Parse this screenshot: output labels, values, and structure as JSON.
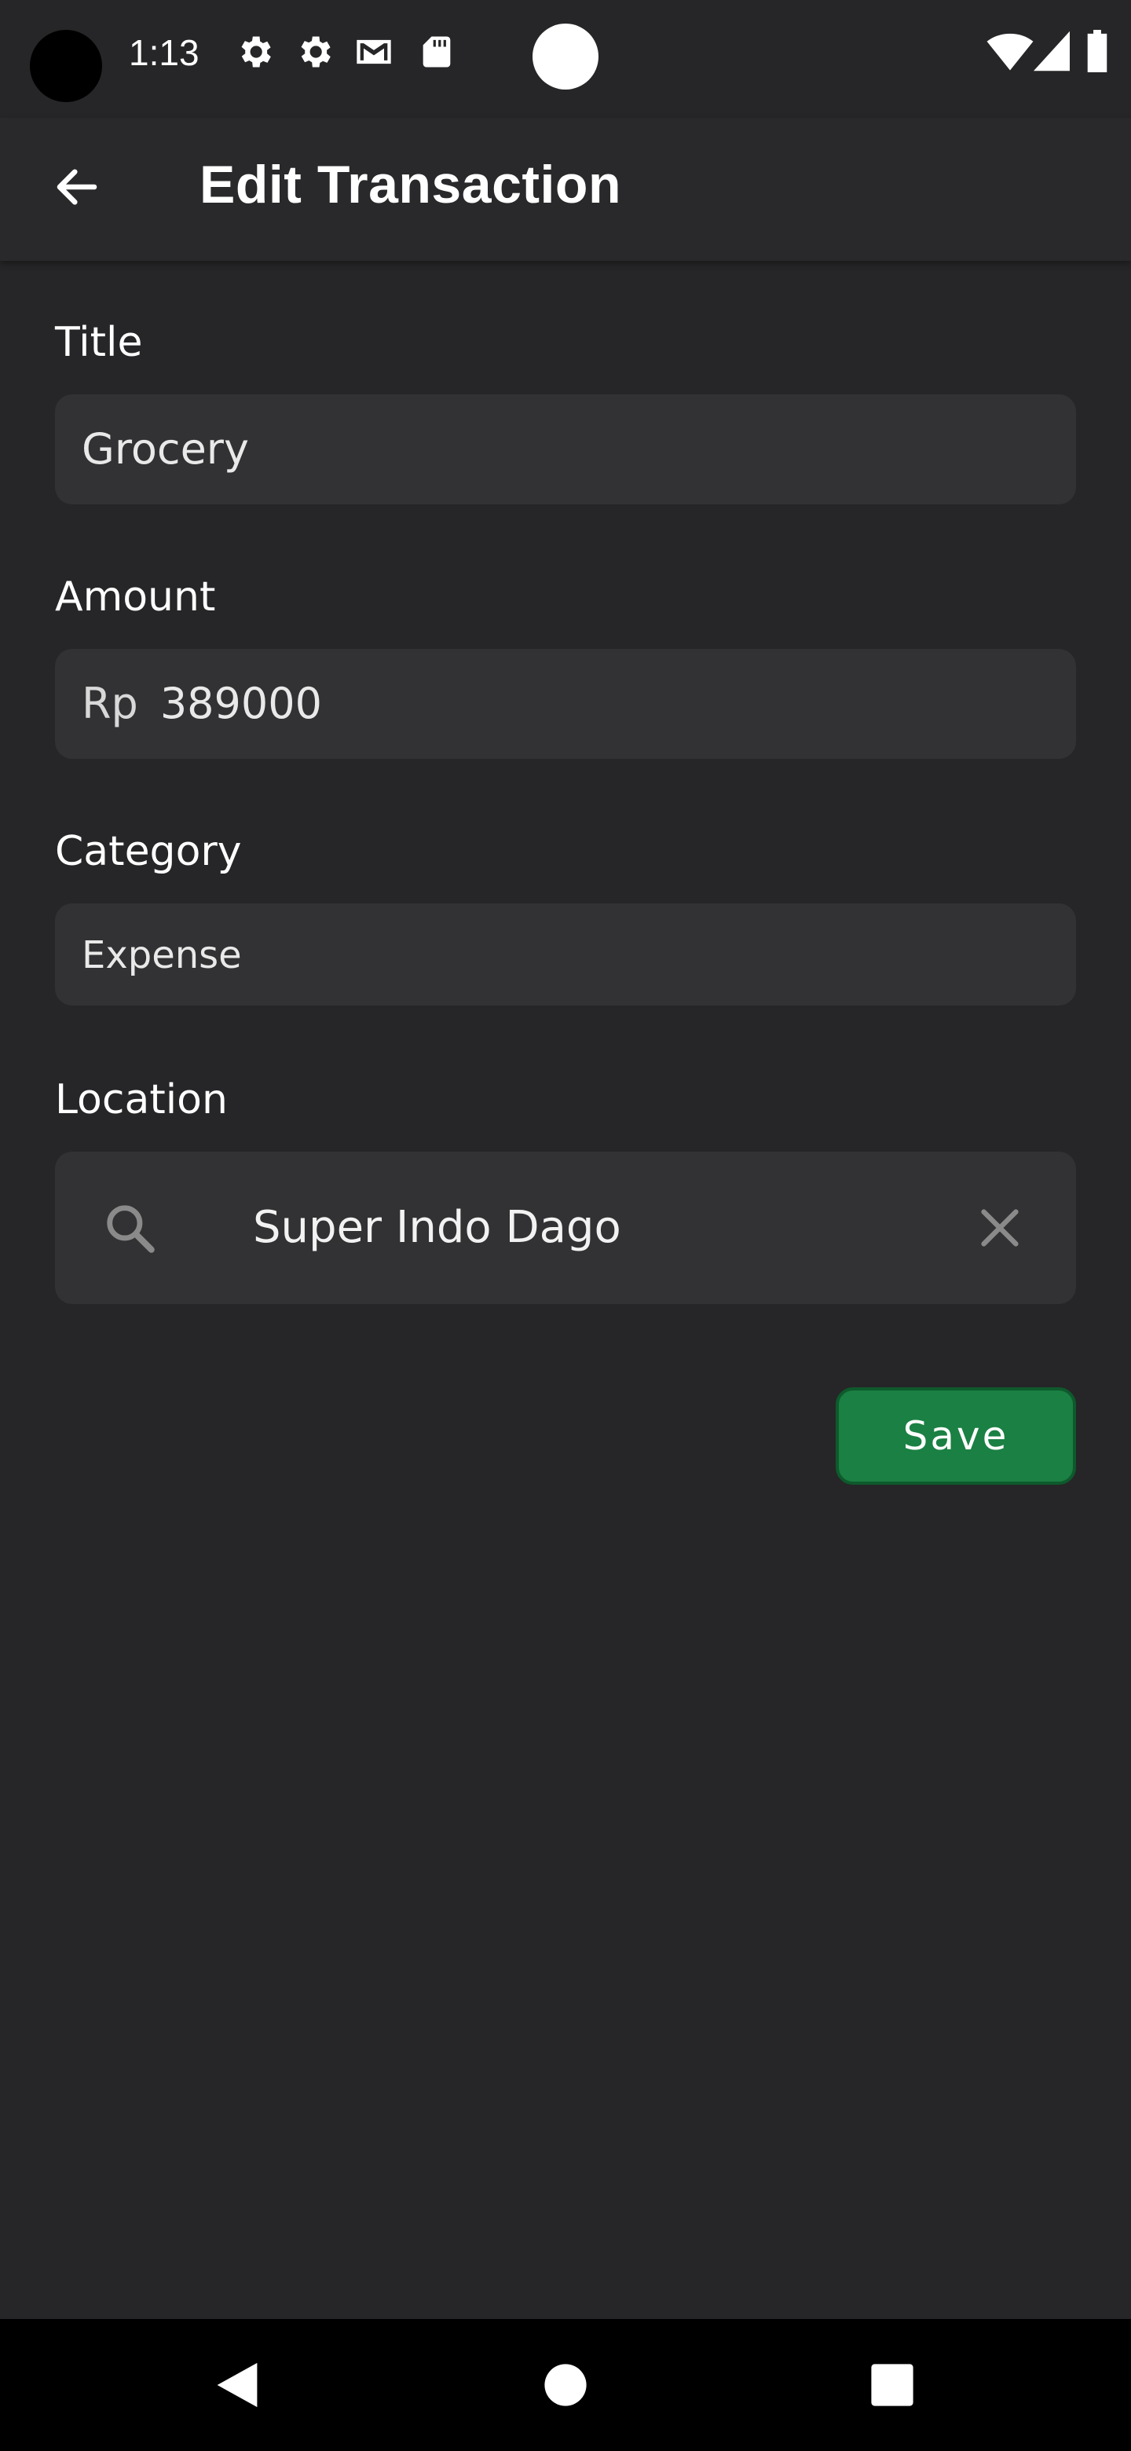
{
  "status_bar": {
    "time": "1:13",
    "icons": [
      "settings-gear-icon",
      "settings-gear-icon",
      "gmail-icon",
      "sd-card-icon"
    ],
    "right_icons": [
      "wifi-icon",
      "signal-icon",
      "battery-icon"
    ]
  },
  "toolbar": {
    "back_icon": "arrow-back-icon",
    "title": "Edit Transaction"
  },
  "form": {
    "title_label": "Title",
    "title_value": "Grocery",
    "amount_label": "Amount",
    "amount_prefix": "Rp",
    "amount_value": "389000",
    "category_label": "Category",
    "category_value": "Expense",
    "location_label": "Location",
    "location_value": "Super Indo Dago",
    "save_label": "Save"
  },
  "nav_bar": {
    "buttons": [
      "back-triangle-icon",
      "home-circle-icon",
      "recents-square-icon"
    ]
  },
  "colors": {
    "background": "#262628",
    "field": "#323234",
    "save_button": "#1b8043"
  }
}
